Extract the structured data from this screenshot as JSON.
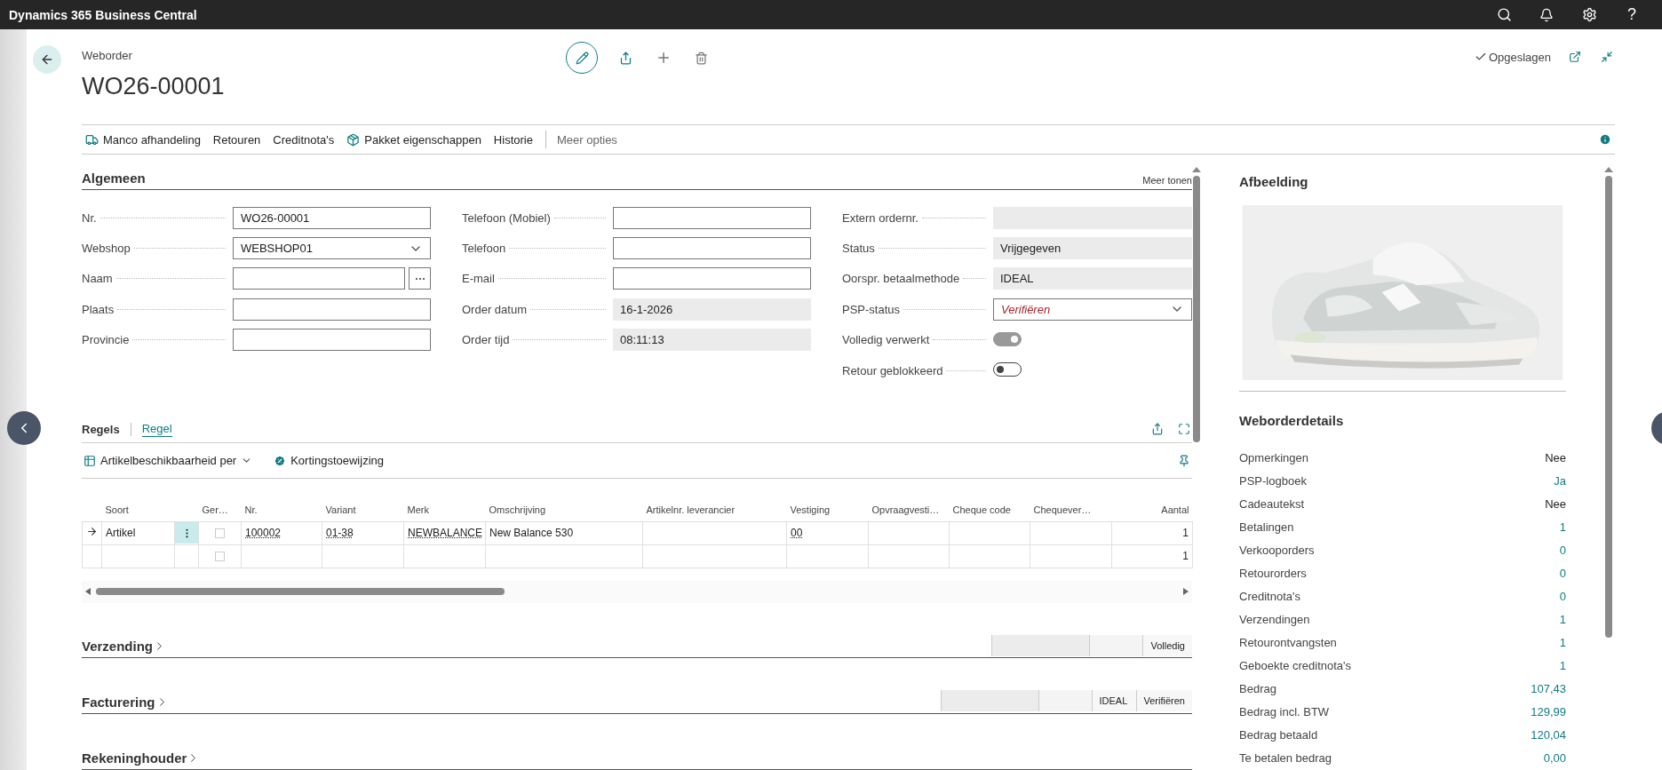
{
  "app_bar": {
    "title": "Dynamics 365 Business Central",
    "help": "?"
  },
  "header": {
    "breadcrumb": "Weborder",
    "title": "WO26-00001",
    "saved_status": "Opgeslagen"
  },
  "actions": [
    {
      "label": "Manco afhandeling",
      "kind": "manco"
    },
    {
      "label": "Retouren",
      "kind": "plain"
    },
    {
      "label": "Creditnota's",
      "kind": "plain"
    },
    {
      "label": "Pakket eigenschappen",
      "kind": "package"
    },
    {
      "label": "Historie",
      "kind": "plain"
    }
  ],
  "more_options": "Meer opties",
  "general": {
    "title": "Algemeen",
    "show_more": "Meer tonen",
    "columns": [
      [
        {
          "label": "Nr.",
          "kind": "text",
          "value": "WO26-00001"
        },
        {
          "label": "Webshop",
          "kind": "dropdown",
          "value": "WEBSHOP01"
        },
        {
          "label": "Naam",
          "kind": "lookup"
        },
        {
          "label": "Plaats",
          "kind": "text"
        },
        {
          "label": "Provincie",
          "kind": "text"
        }
      ],
      [
        {
          "label": "Telefoon (Mobiel)",
          "kind": "text"
        },
        {
          "label": "Telefoon",
          "kind": "text"
        },
        {
          "label": "E-mail",
          "kind": "text"
        },
        {
          "label": "Order datum",
          "kind": "readonly",
          "value": "16-1-2026"
        },
        {
          "label": "Order tijd",
          "kind": "readonly",
          "value": "08:11:13"
        }
      ],
      [
        {
          "label": "Extern ordernr.",
          "kind": "readonly"
        },
        {
          "label": "Status",
          "kind": "readonly",
          "value": "Vrijgegeven"
        },
        {
          "label": "Oorspr. betaalmethode",
          "kind": "readonly",
          "value": "IDEAL"
        },
        {
          "label": "PSP-status",
          "kind": "dropdown",
          "value": "Verifiëren",
          "attention": true
        },
        {
          "label": "Volledig verwerkt",
          "kind": "toggle",
          "on": true,
          "disabled": true
        },
        {
          "label": "Retour geblokkeerd",
          "kind": "toggle",
          "on": false,
          "disabled": false
        }
      ]
    ]
  },
  "lines": {
    "title": "Regels",
    "tabs": [
      {
        "label": "Regel",
        "selected": true
      }
    ],
    "toolbar": [
      {
        "label": "Artikelbeschikbaarheid per",
        "kind": "menu"
      },
      {
        "label": "Kortingstoewijzing",
        "kind": "discount"
      }
    ],
    "columns": [
      {
        "label": "Soort",
        "kind": "text"
      },
      {
        "label": "Ger…",
        "kind": "check"
      },
      {
        "label": "Nr.",
        "kind": "link"
      },
      {
        "label": "Variant",
        "kind": "link"
      },
      {
        "label": "Merk",
        "kind": "link"
      },
      {
        "label": "Omschrijving",
        "kind": "text"
      },
      {
        "label": "Artikelnr. leverancier",
        "kind": "text"
      },
      {
        "label": "Vestiging",
        "kind": "link"
      },
      {
        "label": "Opvraagvesti…",
        "kind": "text"
      },
      {
        "label": "Cheque code",
        "kind": "text"
      },
      {
        "label": "Chequever…",
        "kind": "text"
      },
      {
        "label": "Aantal",
        "kind": "number"
      }
    ],
    "rows": [
      {
        "current": true,
        "checked": false,
        "cells": [
          "Artikel",
          null,
          "100002",
          "01-38",
          "NEWBALANCE",
          "New Balance 530",
          null,
          "00",
          null,
          null,
          null,
          "1"
        ]
      },
      {
        "current": false,
        "checked": false,
        "cells": [
          null,
          null,
          null,
          null,
          null,
          null,
          null,
          null,
          null,
          null,
          null,
          "1"
        ]
      }
    ]
  },
  "sections": [
    {
      "title": "Verzending",
      "summary": [
        {
          "kind": "readonly"
        },
        {
          "kind": "blank"
        },
        {
          "kind": "value",
          "text": "Volledig"
        }
      ]
    },
    {
      "title": "Facturering",
      "summary": [
        {
          "kind": "readonly"
        },
        {
          "kind": "blank"
        },
        {
          "kind": "value",
          "text": "IDEAL"
        },
        {
          "kind": "value",
          "text": "Verifiëren"
        }
      ]
    },
    {
      "title": "Rekeninghouder"
    }
  ],
  "factbox": {
    "image_title": "Afbeelding",
    "details_title": "Weborderdetails",
    "details": [
      {
        "label": "Opmerkingen",
        "value": "Nee",
        "link": false
      },
      {
        "label": "PSP-logboek",
        "value": "Ja",
        "link": true
      },
      {
        "label": "Cadeautekst",
        "value": "Nee",
        "link": false
      },
      {
        "label": "Betalingen",
        "value": "1",
        "link": true
      },
      {
        "label": "Verkooporders",
        "value": "0",
        "link": true
      },
      {
        "label": "Retourorders",
        "value": "0",
        "link": true
      },
      {
        "label": "Creditnota's",
        "value": "0",
        "link": true
      },
      {
        "label": "Verzendingen",
        "value": "1",
        "link": true
      },
      {
        "label": "Retourontvangsten",
        "value": "1",
        "link": true
      },
      {
        "label": "Geboekte creditnota's",
        "value": "1",
        "link": true
      },
      {
        "label": "Bedrag",
        "value": "107,43",
        "link": true
      },
      {
        "label": "Bedrag incl. BTW",
        "value": "129,99",
        "link": true
      },
      {
        "label": "Bedrag betaald",
        "value": "120,04",
        "link": true
      },
      {
        "label": "Te betalen bedrag",
        "value": "0,00",
        "link": true
      }
    ]
  }
}
